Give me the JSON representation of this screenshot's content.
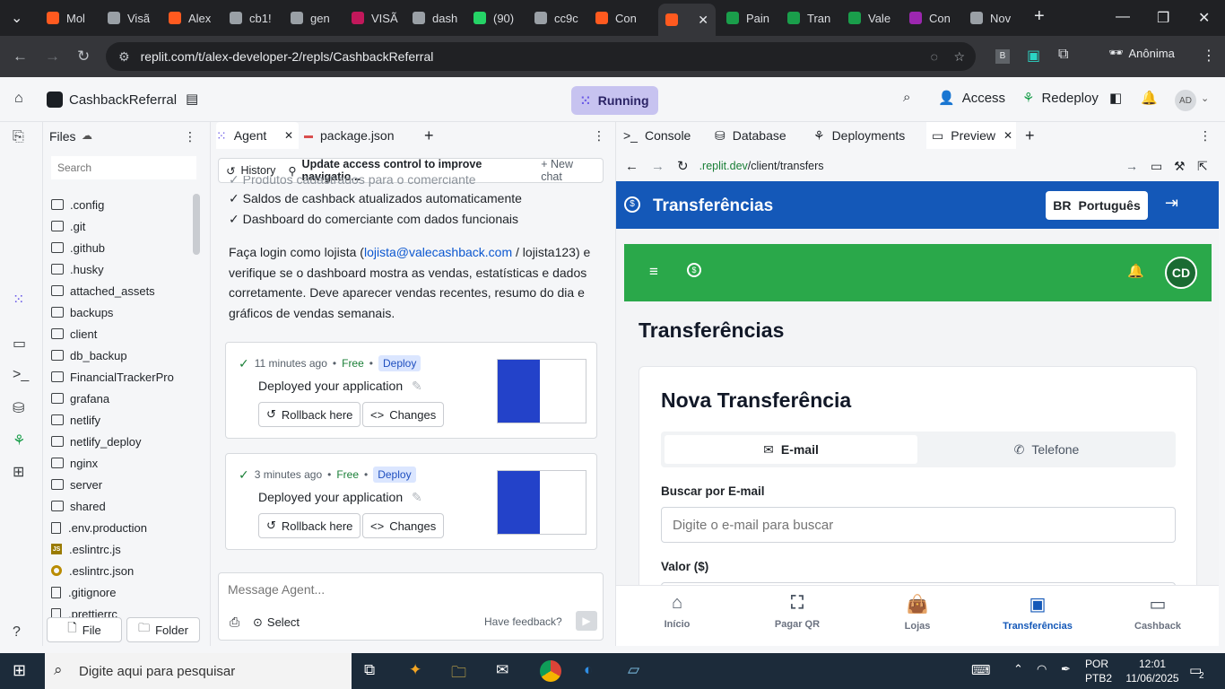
{
  "browser": {
    "tabs": [
      {
        "label": "Mol",
        "color": "#ff5a1f"
      },
      {
        "label": "Visã",
        "color": "#9aa0a6"
      },
      {
        "label": "Alex",
        "color": "#ff5a1f"
      },
      {
        "label": "cb1!",
        "color": "#9aa0a6"
      },
      {
        "label": "gen",
        "color": "#9aa0a6"
      },
      {
        "label": "VISÃ",
        "color": "#c2185b"
      },
      {
        "label": "dash",
        "color": "#9aa0a6"
      },
      {
        "label": "(90)",
        "color": "#25d366"
      },
      {
        "label": "cc9c",
        "color": "#9aa0a6"
      },
      {
        "label": "Con",
        "color": "#ff5a1f"
      },
      {
        "label": "",
        "color": "#ff5a1f"
      },
      {
        "label": "Pain",
        "color": "#1a9e4b"
      },
      {
        "label": "Tran",
        "color": "#1a9e4b"
      },
      {
        "label": "Vale",
        "color": "#1a9e4b"
      },
      {
        "label": "Con",
        "color": "#9c27b0"
      },
      {
        "label": "Nov",
        "color": "#9aa0a6"
      }
    ],
    "url": "replit.com/t/alex-developer-2/repls/CashbackReferral",
    "profile_label": "Anônima"
  },
  "replit": {
    "project_name": "CashbackReferral",
    "status": "Running",
    "access_label": "Access",
    "redeploy_label": "Redeploy",
    "avatar": "AD"
  },
  "files": {
    "title": "Files",
    "search_placeholder": "Search",
    "items": [
      {
        "name": ".config",
        "type": "folder"
      },
      {
        "name": ".git",
        "type": "folder"
      },
      {
        "name": ".github",
        "type": "folder"
      },
      {
        "name": ".husky",
        "type": "folder"
      },
      {
        "name": "attached_assets",
        "type": "folder"
      },
      {
        "name": "backups",
        "type": "folder"
      },
      {
        "name": "client",
        "type": "folder"
      },
      {
        "name": "db_backup",
        "type": "folder"
      },
      {
        "name": "FinancialTrackerPro",
        "type": "folder"
      },
      {
        "name": "grafana",
        "type": "folder"
      },
      {
        "name": "netlify",
        "type": "folder"
      },
      {
        "name": "netlify_deploy",
        "type": "folder"
      },
      {
        "name": "nginx",
        "type": "folder"
      },
      {
        "name": "server",
        "type": "folder"
      },
      {
        "name": "shared",
        "type": "folder"
      },
      {
        "name": ".env.production",
        "type": "file"
      },
      {
        "name": ".eslintrc.js",
        "type": "js"
      },
      {
        "name": ".eslintrc.json",
        "type": "json"
      },
      {
        "name": ".gitignore",
        "type": "file"
      },
      {
        "name": ".prettierrc",
        "type": "file"
      }
    ],
    "new_file_label": "File",
    "new_folder_label": "Folder"
  },
  "agent": {
    "tab_agent": "Agent",
    "tab_package": "package.json",
    "history_label": "History",
    "chat_title": "Update access control to improve navigatio...",
    "new_chat_label": "New chat",
    "checklist": [
      "✓ Produtos cadastrados para o comerciante",
      "✓ Saldos de cashback atualizados automaticamente",
      "✓ Dashboard do comerciante com dados funcionais"
    ],
    "instruction_pre": "Faça login como lojista (",
    "instruction_email": "lojista@valecashback.com",
    "instruction_post": " / lojista123) e",
    "instruction_lines": [
      "verifique se o dashboard mostra as vendas, estatísticas e dados",
      "corretamente. Deve aparecer vendas recentes, resumo do dia e",
      "gráficos de vendas semanais."
    ],
    "cards": [
      {
        "time": "11 minutes ago",
        "plan": "Free",
        "badge": "Deploy",
        "title": "Deployed your application",
        "rollback": "Rollback here",
        "changes": "Changes"
      },
      {
        "time": "3 minutes ago",
        "plan": "Free",
        "badge": "Deploy",
        "title": "Deployed your application",
        "rollback": "Rollback here",
        "changes": "Changes"
      }
    ],
    "message_placeholder": "Message Agent...",
    "select_label": "Select",
    "feedback_label": "Have feedback?"
  },
  "preview_panel": {
    "tabs": [
      "Console",
      "Database",
      "Deployments",
      "Preview"
    ],
    "url_prefix": ".replit.dev",
    "url_path": "/client/transfers"
  },
  "app": {
    "header_title": "Transferências",
    "lang_code": "BR",
    "lang_label": "Português",
    "avatar": "CD",
    "page_title": "Transferências",
    "form_title": "Nova Transferência",
    "tab_email": "E-mail",
    "tab_phone": "Telefone",
    "search_label": "Buscar por E-mail",
    "search_placeholder": "Digite o e-mail para buscar",
    "amount_label": "Valor ($)",
    "nav": [
      "Início",
      "Pagar QR",
      "Lojas",
      "Transferências",
      "Cashback"
    ],
    "active_color": "#1458b8"
  },
  "taskbar": {
    "search_placeholder": "Digite aqui para pesquisar",
    "lang": "POR",
    "layout": "PTB2",
    "time": "12:01",
    "date": "11/06/2025",
    "notifications": "2"
  }
}
